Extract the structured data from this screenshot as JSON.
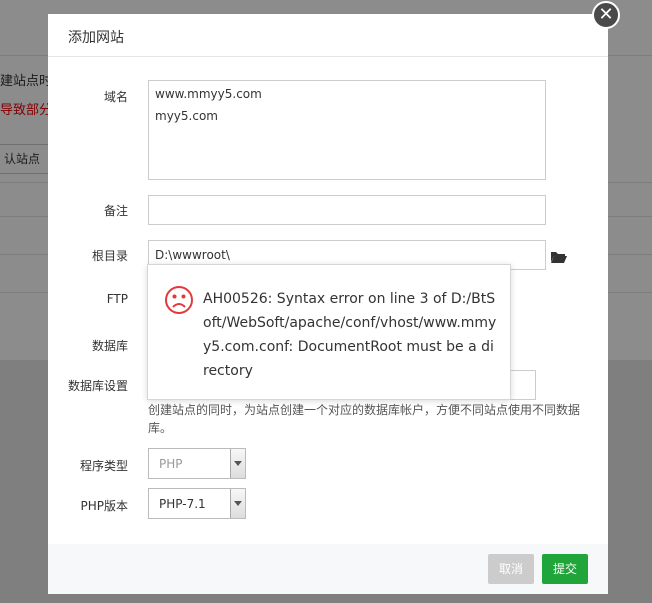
{
  "background": {
    "text_line1": "建站点时会",
    "text_line2": "导致部分",
    "button_label": "认站点"
  },
  "modal": {
    "title": "添加网站",
    "close_icon": "close-icon",
    "fields": {
      "domain": {
        "label": "域名",
        "lines": [
          "www.mmyy5.com",
          "myy5.com"
        ]
      },
      "remark": {
        "label": "备注",
        "value": ""
      },
      "root": {
        "label": "根目录",
        "value": "D:\\wwwroot\\"
      },
      "ftp": {
        "label": "FTP"
      },
      "database": {
        "label": "数据库"
      },
      "db_settings": {
        "label": "数据库设置"
      },
      "program_type": {
        "label": "程序类型",
        "value": "PHP"
      },
      "php_version": {
        "label": "PHP版本",
        "value": "PHP-7.1"
      }
    },
    "db_hint": "创建站点的同时，为站点创建一个对应的数据库帐户，方便不同站点使用不同数据库。",
    "buttons": {
      "cancel": "取消",
      "submit": "提交"
    }
  },
  "error_popup": {
    "icon": "sad-face-icon",
    "message": "AH00526: Syntax error on line 3 of D:/BtSoft/WebSoft/apache/conf/vhost/www.mmyy5.com.conf: DocumentRoot must be a directory"
  },
  "colors": {
    "submit": "#20a53a",
    "error_icon": "#e4393c",
    "cancel": "#cccccc"
  }
}
